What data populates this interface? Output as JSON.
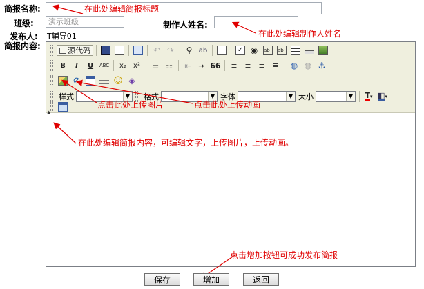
{
  "form": {
    "title_label": "简报名称:",
    "class_label": "班级:",
    "class_placeholder": "演示班级",
    "author_label": "制作人姓名:",
    "publisher_label": "发布人:",
    "publisher_value": "T辅导01",
    "content_label": "简报内容:"
  },
  "toolbar": {
    "source_label": "源代码",
    "bold": "B",
    "italic": "I",
    "underline": "U",
    "strike": "ABC",
    "subscript": "x₂",
    "superscript": "x²",
    "blockquote": "66",
    "style_label": "样式",
    "format_label": "格式",
    "font_label": "字体",
    "size_label": "大小"
  },
  "annotations": {
    "title": "在此处编辑简报标题",
    "author": "在此处编辑制作人姓名",
    "upload_image": "点击此处上传图片",
    "upload_flash": "点击此处上传动画",
    "content": "在此处编辑简报内容，可编辑文字，上传图片，上传动画。",
    "add": "点击增加按钮可成功发布简报"
  },
  "buttons": {
    "save": "保存",
    "add": "增加",
    "back": "返回"
  },
  "colors": {
    "annotation": "#e00000",
    "toolbar_bg": "#efefde"
  }
}
